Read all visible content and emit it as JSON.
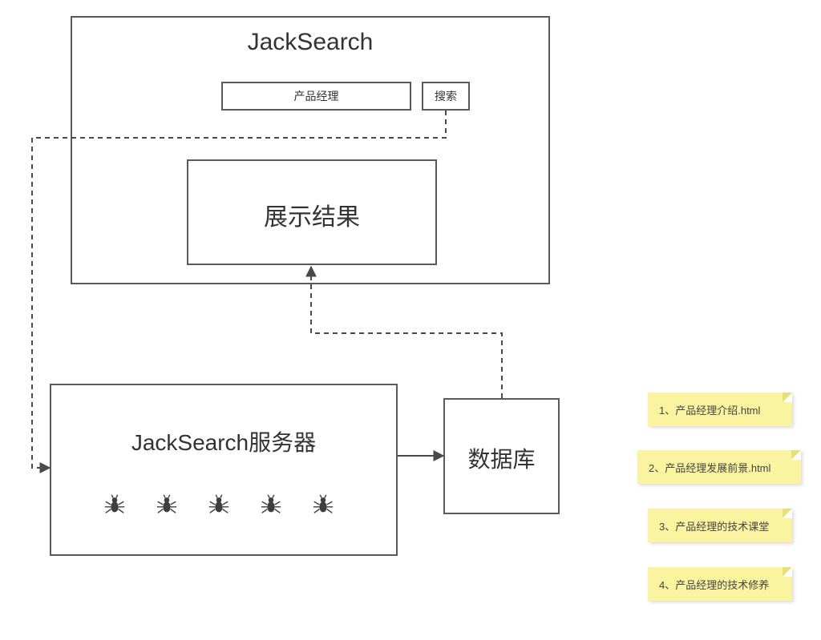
{
  "client": {
    "title": "JackSearch",
    "search_input": "产品经理",
    "search_button": "搜索",
    "results_label": "展示结果"
  },
  "server": {
    "title": "JackSearch服务器",
    "crawler_count": 5
  },
  "database": {
    "label": "数据库"
  },
  "notes": [
    "1、产品经理介绍.html",
    "2、产品经理发展前景.html",
    "3、产品经理的技术课堂",
    "4、产品经理的技术修养"
  ]
}
